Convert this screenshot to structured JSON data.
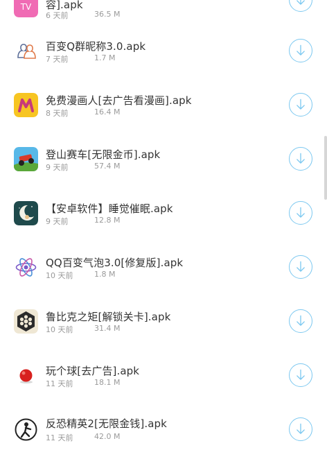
{
  "download_list": {
    "items": [
      {
        "name": "容].apk",
        "age": "6 天前",
        "size": "36.5 M",
        "icon": "tv-pink-app-icon"
      },
      {
        "name": "百变Q群昵称3.0.apk",
        "age": "7 天前",
        "size": "1.7 M",
        "icon": "qq-group-users-icon"
      },
      {
        "name": "免费漫画人[去广告看漫画].apk",
        "age": "8 天前",
        "size": "16.4 M",
        "icon": "manhuaren-m-icon"
      },
      {
        "name": "登山赛车[无限金币].apk",
        "age": "9 天前",
        "size": "57.4 M",
        "icon": "hill-climb-car-icon"
      },
      {
        "name": "【安卓软件】睡觉催眠.apk",
        "age": "9 天前",
        "size": "12.8 M",
        "icon": "moon-sleep-icon"
      },
      {
        "name": "QQ百变气泡3.0[修复版].apk",
        "age": "10 天前",
        "size": "1.8 M",
        "icon": "atom-bubble-icon"
      },
      {
        "name": "鲁比克之矩[解锁关卡].apk",
        "age": "10 天前",
        "size": "31.4 M",
        "icon": "rubik-flower-icon"
      },
      {
        "name": "玩个球[去广告].apk",
        "age": "11 天前",
        "size": "18.1 M",
        "icon": "red-ball-icon"
      },
      {
        "name": "反恐精英2[无限金钱].apk",
        "age": "11 天前",
        "size": "42.0 M",
        "icon": "soldier-icon"
      }
    ]
  },
  "colors": {
    "accent": "#7cc8f0",
    "title_text": "#333333",
    "meta_text": "#9a9a9a"
  }
}
